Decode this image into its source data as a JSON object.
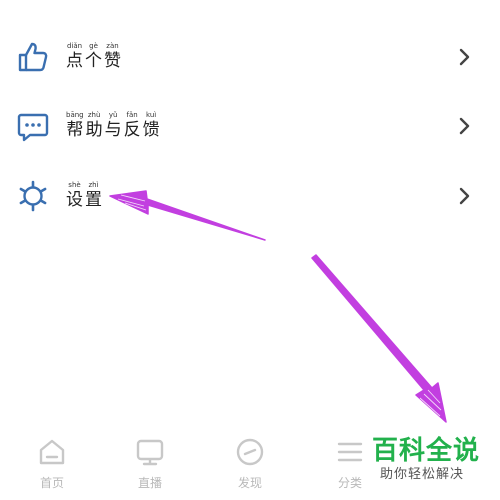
{
  "menu": {
    "items": [
      {
        "icon": "thumbs-up-icon",
        "chars": [
          {
            "py": "diǎn",
            "hz": "点"
          },
          {
            "py": "gè",
            "hz": "个"
          },
          {
            "py": "zàn",
            "hz": "赞"
          }
        ]
      },
      {
        "icon": "chat-bubble-icon",
        "chars": [
          {
            "py": "bāng",
            "hz": "帮"
          },
          {
            "py": "zhù",
            "hz": "助"
          },
          {
            "py": "yǔ",
            "hz": "与"
          },
          {
            "py": "fǎn",
            "hz": "反"
          },
          {
            "py": "kuì",
            "hz": "馈"
          }
        ]
      },
      {
        "icon": "gear-icon",
        "chars": [
          {
            "py": "shè",
            "hz": "设"
          },
          {
            "py": "zhì",
            "hz": "置"
          }
        ]
      }
    ]
  },
  "tabbar": {
    "tabs": [
      {
        "label": "首页",
        "icon": "home-icon"
      },
      {
        "label": "直播",
        "icon": "live-tv-icon"
      },
      {
        "label": "发现",
        "icon": "compass-icon"
      },
      {
        "label": "分类",
        "icon": "menu-lines-icon"
      }
    ]
  },
  "watermark": {
    "title": "百科全说",
    "subtitle": "助你轻松解决"
  },
  "colors": {
    "accent_icon": "#3a6fb0",
    "arrow": "#c23fe0",
    "watermark": "#22b14c",
    "tab_inactive": "#c8c8c8"
  }
}
